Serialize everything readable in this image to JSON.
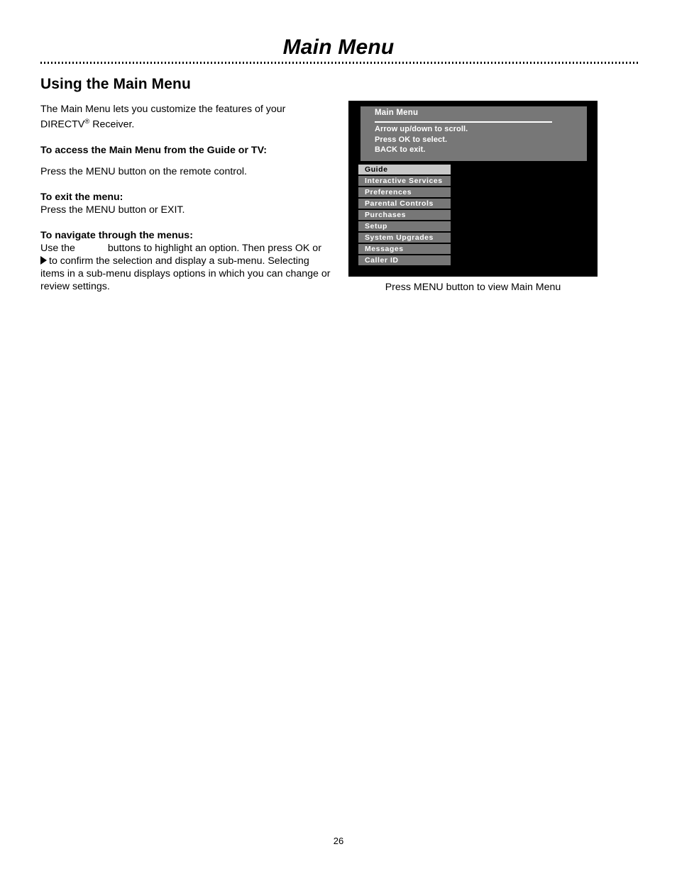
{
  "page": {
    "title": "Main Menu",
    "number": "26"
  },
  "content": {
    "section_heading": "Using the Main Menu",
    "intro_line1": "The Main Menu lets you customize the features of your",
    "intro_brand": "DIRECTV",
    "intro_sup": "®",
    "intro_line2_rest": " Receiver.",
    "access_heading": "To access the Main Menu from the Guide or TV:",
    "access_body": "Press the MENU button on the remote control.",
    "exit_heading": "To exit the menu:",
    "exit_body": "Press the MENU button or EXIT.",
    "navigate_heading": "To navigate through the menus:",
    "navigate_line1_a": "Use the",
    "navigate_line1_b": "buttons to highlight an option. Then press OK or",
    "navigate_line2": "to confirm the selection and display a sub-menu. Selecting",
    "navigate_line3": "items in a sub-menu displays options in which you can change or",
    "navigate_line4": "review settings."
  },
  "tv": {
    "osd_title": "Main Menu",
    "osd_instructions": [
      "Arrow up/down to scroll.",
      "Press OK to select.",
      "BACK to exit."
    ],
    "menu_items": [
      {
        "label": "Guide",
        "selected": true
      },
      {
        "label": "Interactive Services",
        "selected": false
      },
      {
        "label": "Preferences",
        "selected": false
      },
      {
        "label": "Parental Controls",
        "selected": false
      },
      {
        "label": "Purchases",
        "selected": false
      },
      {
        "label": "Setup",
        "selected": false
      },
      {
        "label": "System Upgrades",
        "selected": false
      },
      {
        "label": "Messages",
        "selected": false
      },
      {
        "label": "Caller ID",
        "selected": false
      }
    ],
    "caption": "Press MENU button to view Main Menu"
  },
  "colors": {
    "osd_panel_gray": "#777777",
    "osd_selected_gray": "#c8c8c8",
    "tv_frame_black": "#000000",
    "text_white": "#ffffff"
  }
}
